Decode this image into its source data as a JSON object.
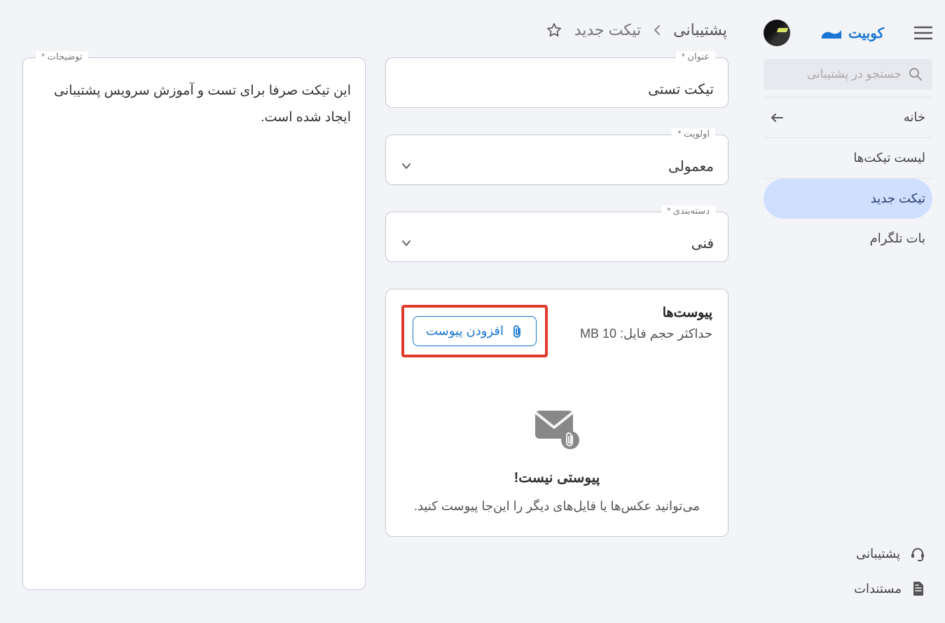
{
  "brand": "کوبیت",
  "search": {
    "placeholder": "جستجو در پشتیبانی"
  },
  "sidebar": {
    "items": [
      {
        "label": "خانه",
        "hasArrow": true
      },
      {
        "label": "لیست تیکت‌ها"
      },
      {
        "label": "تیکت جدید",
        "active": true
      },
      {
        "label": "بات تلگرام"
      }
    ],
    "footer": [
      {
        "label": "پشتیبانی"
      },
      {
        "label": "مستندات"
      }
    ]
  },
  "breadcrumb": {
    "root": "پشتیبانی",
    "current": "تیکت جدید"
  },
  "form": {
    "title_label": "عنوان *",
    "title_value": "تیکت تستی",
    "priority_label": "اولویت *",
    "priority_value": "معمولی",
    "category_label": "دسته‌بندی *",
    "category_value": "فنی",
    "desc_label": "توضیحات *",
    "desc_value": "این تیکت صرفا برای تست و آموزش سرویس پشتیبانی ایجاد شده است."
  },
  "attachments": {
    "title": "پیوست‌ها",
    "max_label": "حداکثر حجم فایل: 10 MB",
    "add_label": "افزودن پیوست",
    "empty_title": "پیوستی نیست!",
    "empty_desc": "می‌توانید عکس‌ها یا فایل‌های دیگر را این‌جا پیوست کنید."
  }
}
